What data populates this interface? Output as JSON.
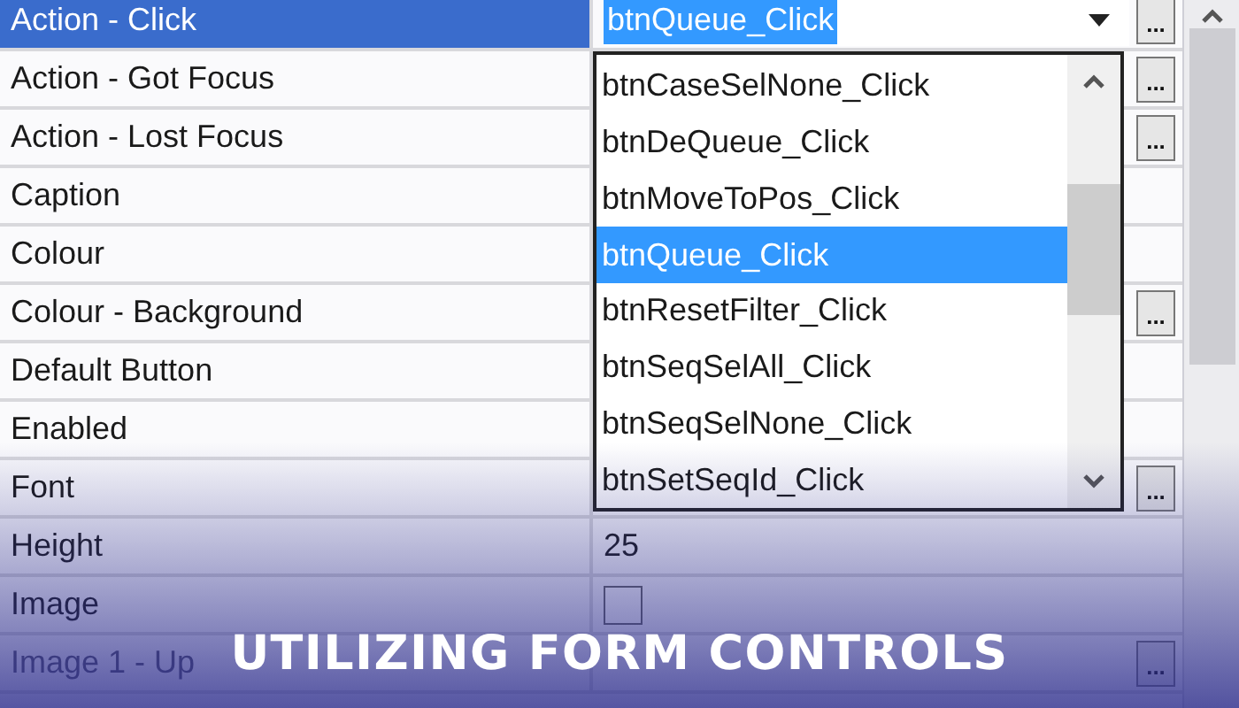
{
  "properties": [
    {
      "label": "Action - Click",
      "kind": "dropdown",
      "value": "btnQueue_Click",
      "selected": true,
      "disabled": false,
      "button": "..."
    },
    {
      "label": "Action - Got Focus",
      "kind": "text",
      "selected": false,
      "disabled": false,
      "button": "..."
    },
    {
      "label": "Action - Lost Focus",
      "kind": "text",
      "selected": false,
      "disabled": false,
      "button": "..."
    },
    {
      "label": "Caption",
      "kind": "text",
      "selected": false,
      "disabled": false
    },
    {
      "label": "Colour",
      "kind": "text",
      "selected": false,
      "disabled": false
    },
    {
      "label": "Colour - Background",
      "kind": "text",
      "selected": false,
      "disabled": false,
      "button": "..."
    },
    {
      "label": "Default Button",
      "kind": "text",
      "selected": false,
      "disabled": false
    },
    {
      "label": "Enabled",
      "kind": "text",
      "selected": false,
      "disabled": false
    },
    {
      "label": "Font",
      "kind": "text",
      "selected": false,
      "disabled": false,
      "button": "..."
    },
    {
      "label": "Height",
      "kind": "text",
      "value": "25",
      "selected": false,
      "disabled": false
    },
    {
      "label": "Image",
      "kind": "checkbox",
      "checked": false,
      "selected": false,
      "disabled": false
    },
    {
      "label": "Image 1 - Up",
      "kind": "text",
      "selected": false,
      "disabled": true,
      "button": "..."
    }
  ],
  "dropdown": {
    "items": [
      {
        "label": "btnCaseSelNone_Click",
        "selected": false
      },
      {
        "label": "btnDeQueue_Click",
        "selected": false
      },
      {
        "label": "btnMoveToPos_Click",
        "selected": false
      },
      {
        "label": "btnQueue_Click",
        "selected": true
      },
      {
        "label": "btnResetFilter_Click",
        "selected": false
      },
      {
        "label": "btnSeqSelAll_Click",
        "selected": false
      },
      {
        "label": "btnSeqSelNone_Click",
        "selected": false
      },
      {
        "label": "btnSetSeqId_Click",
        "selected": false
      }
    ]
  },
  "banner": {
    "title": "UTILIZING FORM CONTROLS"
  }
}
